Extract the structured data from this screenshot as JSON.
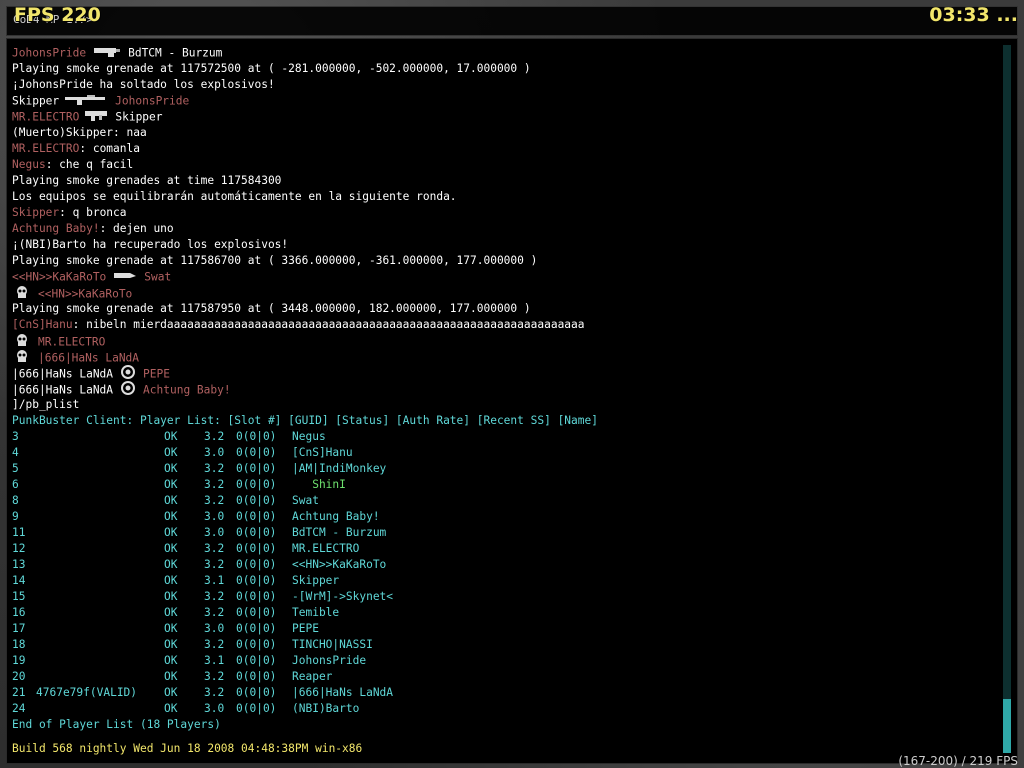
{
  "hud": {
    "fps": "FPS 220",
    "clock": "03:33 ...",
    "prompt": "CoD4 MP 1.7> ",
    "bottom_right": "(167-200) / 219 FPS"
  },
  "lines": {
    "l1_name": "JohonsPride",
    "l1_victim": "BdTCM - Burzum",
    "l2": "Playing smoke grenade at 117572500 at ( -281.000000, -502.000000, 17.000000 )",
    "l3": "¡JohonsPride ha soltado los explosivos!",
    "l4_name": "Skipper",
    "l4_victim": "JohonsPride",
    "l5_name": "MR.ELECTRO",
    "l5_victim": "Skipper",
    "l6_name": "(Muerto)Skipper",
    "l6_msg": ": naa",
    "l7_name": "MR.ELECTRO",
    "l7_msg": ": comanla",
    "l8_name": "Negus",
    "l8_msg": ": che q facil",
    "l9": "Playing smoke grenades at time 117584300",
    "l10": "Los equipos se equilibrarán automáticamente en la siguiente ronda.",
    "l11_name": "Skipper",
    "l11_msg": ": q bronca",
    "l12_name": "Achtung Baby!",
    "l12_msg": ": dejen uno",
    "l13": "¡(NBI)Barto ha recuperado los explosivos!",
    "l14": "Playing smoke grenade at 117586700 at ( 3366.000000, -361.000000, 177.000000 )",
    "l15_name": "<<HN>>KaKaRoTo",
    "l15_victim": "Swat",
    "l16_victim": "<<HN>>KaKaRoTo",
    "l17": "Playing smoke grenade at 117587950 at ( 3448.000000, 182.000000, 177.000000 )",
    "l18_name": "[CnS]Hanu",
    "l18_msg": ": nibeln mierdaaaaaaaaaaaaaaaaaaaaaaaaaaaaaaaaaaaaaaaaaaaaaaaaaaaaaaaaaaaaaa",
    "l19_victim": "MR.ELECTRO",
    "l20_victim": "|666|HaNs LaNdA",
    "l21_name": "|666|HaNs LaNdA",
    "l21_victim": "PEPE",
    "l22_name": "|666|HaNs LaNdA",
    "l22_victim": "Achtung Baby!",
    "l23": "]/pb_plist",
    "l24": "PunkBuster Client: Player List: [Slot #] [GUID] [Status] [Auth Rate] [Recent SS] [Name]",
    "end": "End of Player List (18 Players)"
  },
  "players": [
    {
      "slot": "3",
      "guid": "",
      "status": "OK",
      "rate": "3.2",
      "ss": "0(0|0)",
      "name": "Negus"
    },
    {
      "slot": "4",
      "guid": "",
      "status": "OK",
      "rate": "3.0",
      "ss": "0(0|0)",
      "name": "[CnS]Hanu"
    },
    {
      "slot": "5",
      "guid": "",
      "status": "OK",
      "rate": "3.2",
      "ss": "0(0|0)",
      "name": "|AM|IndiMonkey"
    },
    {
      "slot": "6",
      "guid": "",
      "status": "OK",
      "rate": "3.2",
      "ss": "0(0|0)",
      "name": "   ShinI"
    },
    {
      "slot": "8",
      "guid": "",
      "status": "OK",
      "rate": "3.2",
      "ss": "0(0|0)",
      "name": "Swat"
    },
    {
      "slot": "9",
      "guid": "",
      "status": "OK",
      "rate": "3.0",
      "ss": "0(0|0)",
      "name": "Achtung Baby!"
    },
    {
      "slot": "11",
      "guid": "",
      "status": "OK",
      "rate": "3.0",
      "ss": "0(0|0)",
      "name": "BdTCM - Burzum"
    },
    {
      "slot": "12",
      "guid": "",
      "status": "OK",
      "rate": "3.2",
      "ss": "0(0|0)",
      "name": "MR.ELECTRO"
    },
    {
      "slot": "13",
      "guid": "",
      "status": "OK",
      "rate": "3.2",
      "ss": "0(0|0)",
      "name": "<<HN>>KaKaRoTo"
    },
    {
      "slot": "14",
      "guid": "",
      "status": "OK",
      "rate": "3.1",
      "ss": "0(0|0)",
      "name": "Skipper"
    },
    {
      "slot": "15",
      "guid": "",
      "status": "OK",
      "rate": "3.2",
      "ss": "0(0|0)",
      "name": "-[WrM]->Skynet<"
    },
    {
      "slot": "16",
      "guid": "",
      "status": "OK",
      "rate": "3.2",
      "ss": "0(0|0)",
      "name": "Temible"
    },
    {
      "slot": "17",
      "guid": "",
      "status": "OK",
      "rate": "3.0",
      "ss": "0(0|0)",
      "name": "PEPE"
    },
    {
      "slot": "18",
      "guid": "",
      "status": "OK",
      "rate": "3.2",
      "ss": "0(0|0)",
      "name": "TINCHO|NASSI"
    },
    {
      "slot": "19",
      "guid": "",
      "status": "OK",
      "rate": "3.1",
      "ss": "0(0|0)",
      "name": "JohonsPride"
    },
    {
      "slot": "20",
      "guid": "",
      "status": "OK",
      "rate": "3.2",
      "ss": "0(0|0)",
      "name": "Reaper"
    },
    {
      "slot": "21",
      "guid": "4767e79f(VALID)",
      "status": "OK",
      "rate": "3.2",
      "ss": "0(0|0)",
      "name": "|666|HaNs LaNdA"
    },
    {
      "slot": "24",
      "guid": "",
      "status": "OK",
      "rate": "3.0",
      "ss": "0(0|0)",
      "name": "(NBI)Barto"
    }
  ],
  "build": "Build 568 nightly Wed Jun 18 2008 04:48:38PM win-x86",
  "colors": {
    "name": "#b06060",
    "cyan": "#5fd8d8",
    "yellow": "#f2e66b",
    "green": "#6ee06e"
  }
}
